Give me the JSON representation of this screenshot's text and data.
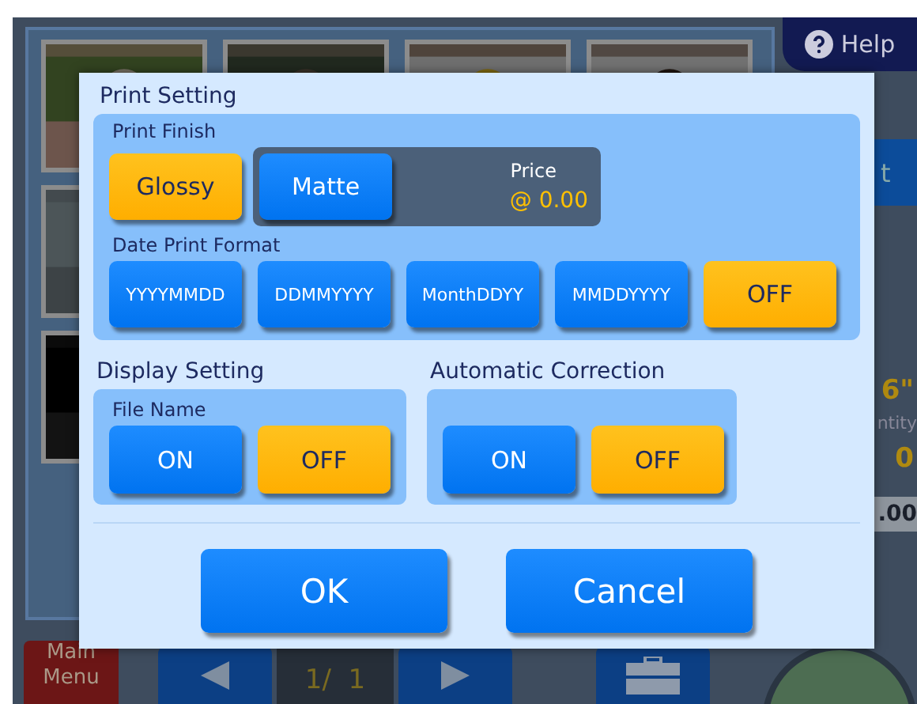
{
  "background": {
    "help_button": "Help",
    "side_button": "t",
    "size": "6\"",
    "quantity_label": "ntity",
    "quantity": "0",
    "total": ".00",
    "main_menu": "Main Menu",
    "page": "1/  1"
  },
  "dialog": {
    "title": "Print Setting",
    "print_finish": {
      "label": "Print Finish",
      "options": [
        {
          "label": "Glossy",
          "selected": true
        },
        {
          "label": "Matte",
          "selected": false
        }
      ],
      "price_label": "Price",
      "price": "@ 0.00"
    },
    "date_format": {
      "label": "Date Print Format",
      "options": [
        {
          "label": "YYYYMMDD",
          "selected": false
        },
        {
          "label": "DDMMYYYY",
          "selected": false
        },
        {
          "label": "MonthDDYY",
          "selected": false
        },
        {
          "label": "MMDDYYYY",
          "selected": false
        },
        {
          "label": "OFF",
          "selected": true
        }
      ]
    },
    "display_setting": {
      "title": "Display Setting",
      "label": "File Name",
      "options": [
        {
          "label": "ON",
          "selected": false
        },
        {
          "label": "OFF",
          "selected": true
        }
      ]
    },
    "automatic_correction": {
      "title": "Automatic Correction",
      "options": [
        {
          "label": "ON",
          "selected": false
        },
        {
          "label": "OFF",
          "selected": true
        }
      ]
    },
    "buttons": [
      "OK",
      "Cancel"
    ]
  }
}
